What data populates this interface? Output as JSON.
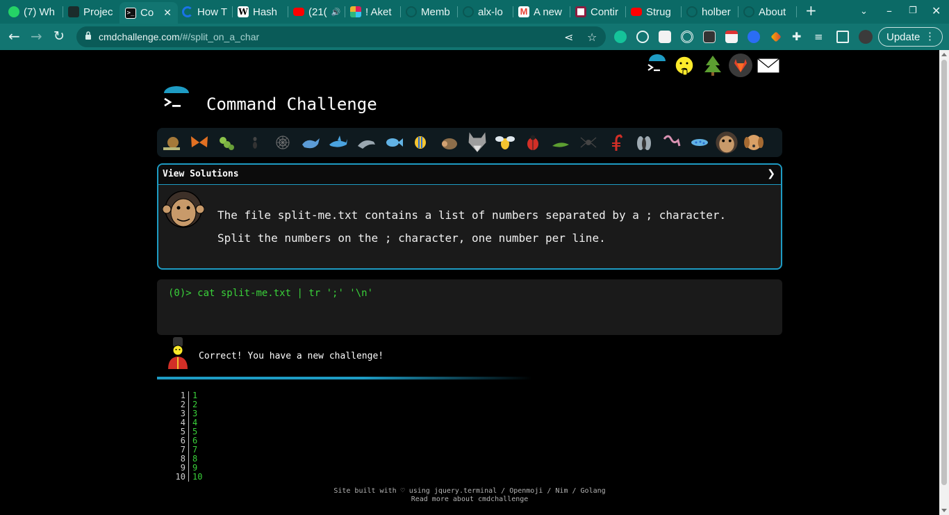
{
  "browser": {
    "tabs": [
      {
        "label": "(7) Wh",
        "icon": "whatsapp-icon",
        "color": "#25d366"
      },
      {
        "label": "Projec",
        "icon": "alx-icon",
        "color": "#2b2b2b"
      },
      {
        "label": "Co",
        "icon": "terminal-icon",
        "color": "#111111",
        "active": true
      },
      {
        "label": "How T",
        "icon": "loader-icon",
        "color": "#1a73e8"
      },
      {
        "label": "Hash",
        "icon": "wikipedia-icon",
        "color": "#ffffff"
      },
      {
        "label": "(21(",
        "icon": "youtube-icon",
        "color": "#ff0000"
      },
      {
        "label": "! Aket",
        "icon": "slack-icon",
        "color": "#e01e5a"
      },
      {
        "label": "Memb",
        "icon": "github-icon",
        "color": "#0f5753"
      },
      {
        "label": "alx-lo",
        "icon": "github-icon",
        "color": "#0f5753"
      },
      {
        "label": "A new",
        "icon": "gmail-icon",
        "color": "#ea4335"
      },
      {
        "label": "Contir",
        "icon": "asu-icon",
        "color": "#ffffff"
      },
      {
        "label": "Strug",
        "icon": "youtube-icon",
        "color": "#ff0000"
      },
      {
        "label": "holber",
        "icon": "github-icon",
        "color": "#0f5753"
      },
      {
        "label": "About",
        "icon": "github-icon",
        "color": "#0f5753"
      }
    ],
    "url_host": "cmdchallenge.com",
    "url_path": "/#/split_on_a_char",
    "update_label": "Update"
  },
  "app": {
    "title": "Command Challenge",
    "solutions_label": "View Solutions",
    "challenge_line_1": "The file split-me.txt contains a list of numbers separated by a ; character.",
    "challenge_line_2": "Split the numbers on the ; character, one number per line.",
    "prompt_prefix": "(0)> ",
    "command": "cat split-me.txt | tr ';' '\\n'",
    "result_message": "Correct! You have a new challenge!",
    "progress": 0.6
  },
  "output": {
    "line_numbers": [
      "1",
      "2",
      "3",
      "4",
      "5",
      "6",
      "7",
      "8",
      "9",
      "10"
    ],
    "values": [
      "1",
      "2",
      "3",
      "4",
      "5",
      "6",
      "7",
      "8",
      "9",
      "10"
    ]
  },
  "footer": {
    "line_1": "Site built with ♡ using jquery.terminal / Openmoji / Nim / Golang",
    "line_2": "Read more about cmdchallenge"
  },
  "colors": {
    "accent": "#1e9cc4",
    "terminal_green": "#3ad13a",
    "chrome": "#127571"
  }
}
